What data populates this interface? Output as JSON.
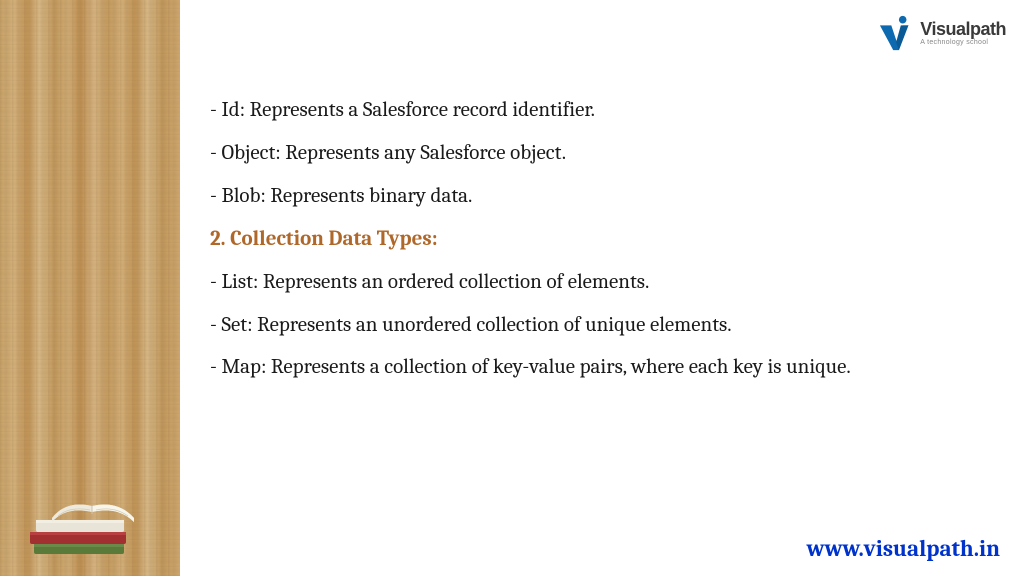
{
  "logo": {
    "name": "Visualpath",
    "tagline": "A technology school"
  },
  "content": {
    "bullets_top": [
      " - Id: Represents a Salesforce record identifier.",
      " - Object: Represents any Salesforce object.",
      " - Blob: Represents binary data."
    ],
    "section_heading": "2. Collection Data Types:",
    "bullets_bottom": [
      " - List: Represents an ordered collection of elements.",
      " - Set: Represents an unordered collection of unique elements.",
      " - Map: Represents a collection of key-value pairs, where each key is unique."
    ]
  },
  "footer": {
    "url": "www.visualpath.in"
  }
}
